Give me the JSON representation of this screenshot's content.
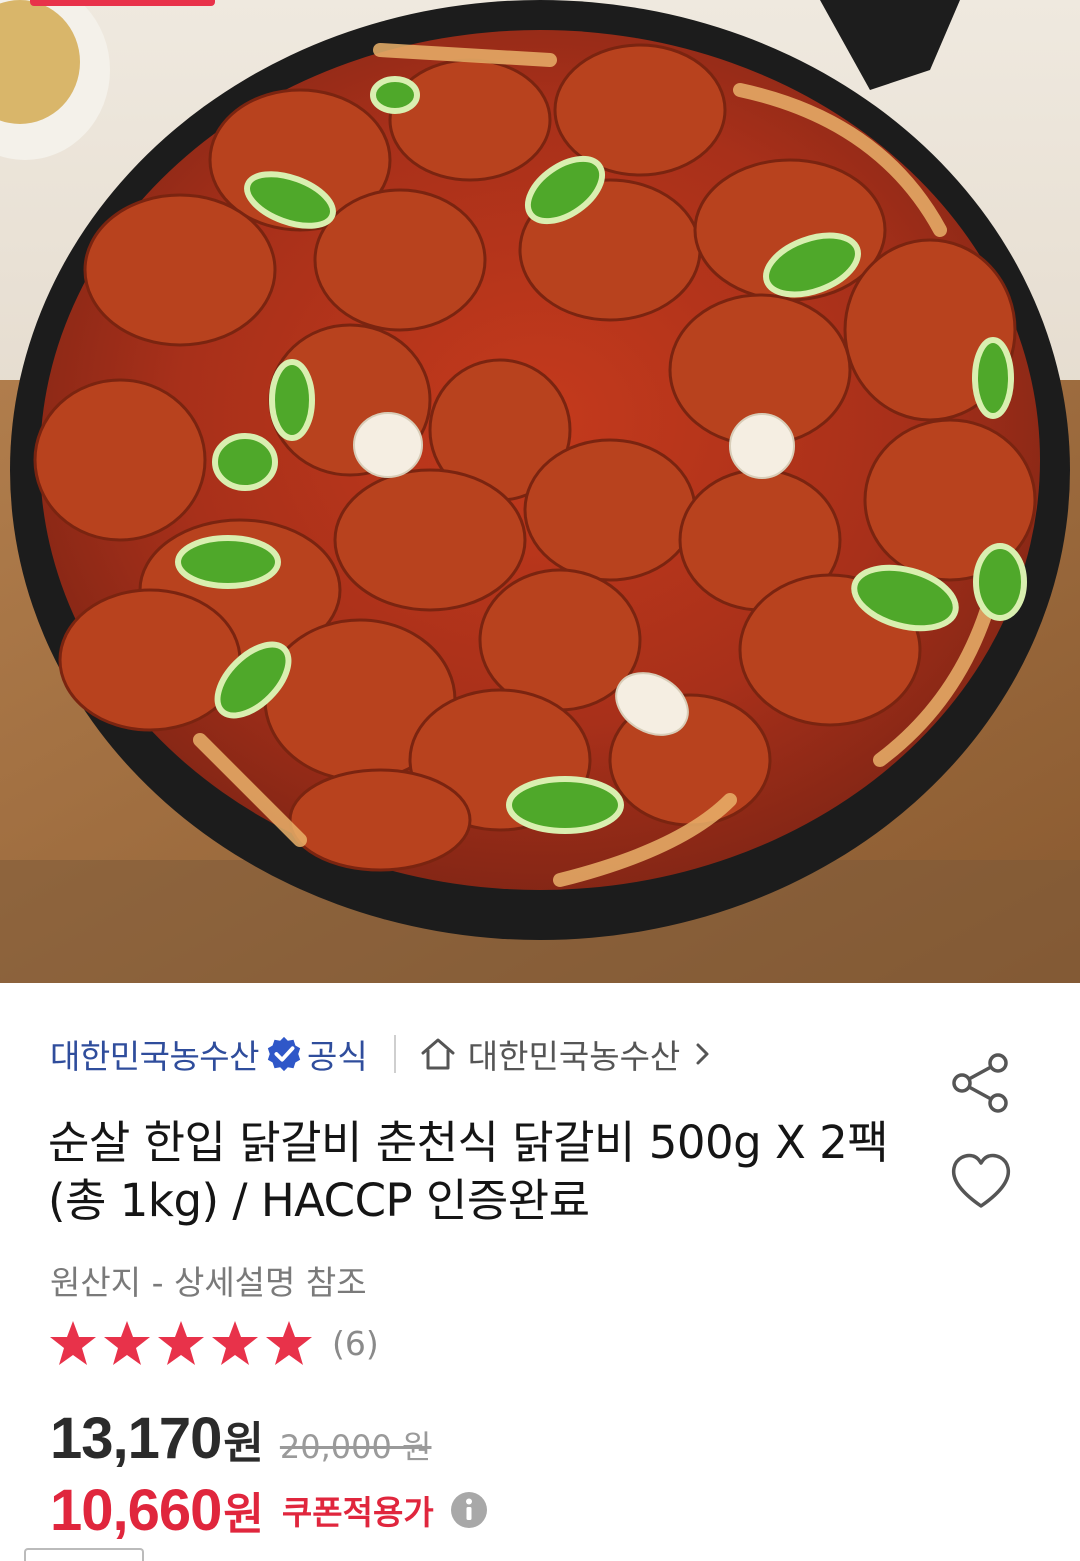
{
  "product_image": {
    "alt": "순살 한입 닭갈비"
  },
  "seller": {
    "name": "대한민국농수산",
    "official_label": "공식",
    "store_name": "대한민국농수산"
  },
  "product": {
    "title": "순살 한입 닭갈비 춘천식 닭갈비 500g X 2팩 (총 1kg) / HACCP 인증완료",
    "origin": "원산지 - 상세설명 참조",
    "rating": 5,
    "review_count": "(6)"
  },
  "price": {
    "sale_price": "13,170",
    "unit": "원",
    "original_price": "20,000 원",
    "coupon_price": "10,660",
    "coupon_unit": "원",
    "coupon_label": "쿠폰적용가"
  },
  "colors": {
    "seller_blue": "#2f4d9c",
    "star_red": "#e8324a",
    "coupon_red": "#e0263d"
  },
  "icons": [
    "verified-badge-icon",
    "home-icon",
    "chevron-right-icon",
    "share-icon",
    "heart-icon",
    "star-icon",
    "info-icon"
  ]
}
